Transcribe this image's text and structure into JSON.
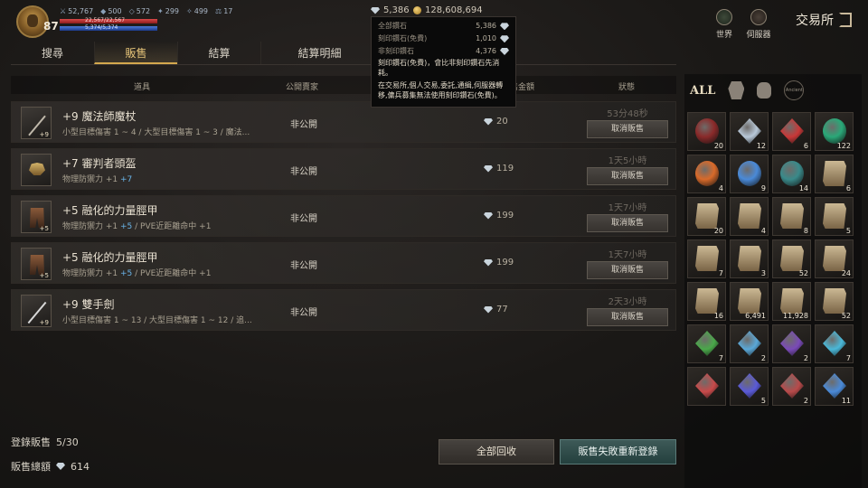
{
  "player": {
    "level": "87",
    "stats": [
      "52,767",
      "500",
      "572",
      "299",
      "499",
      "17"
    ],
    "hp_text": "22,567/22,567",
    "hp_fraction": 1.0,
    "mp_text": "5,374/5,374",
    "mp_fraction": 1.0
  },
  "currency": {
    "diamond": "5,386",
    "gold": "128,608,694"
  },
  "top_right": {
    "world_label": "世界",
    "server_label": "伺服器",
    "exchange_title": "交易所"
  },
  "tabs": [
    {
      "label": "搜尋",
      "active": false
    },
    {
      "label": "販售",
      "active": true
    },
    {
      "label": "結算",
      "active": false
    },
    {
      "label": "結算明細",
      "active": false
    }
  ],
  "columns": {
    "item": "道具",
    "public": "公開賣家",
    "amount": "售金額",
    "status": "狀態"
  },
  "tooltip": {
    "lines": [
      {
        "label": "全部鑽石",
        "value": "5,386"
      },
      {
        "label": "刻印鑽石(免費)",
        "value": "1,010"
      },
      {
        "label": "非刻印鑽石",
        "value": "4,376"
      }
    ],
    "note1": "刻印鑽石(免費)，會比非刻印鑽石先消耗。",
    "note2": "在交易所,個人交易,委託,通緝,伺服器轉移,傭兵募集無法使用刻印鑽石(免費)。"
  },
  "listings": [
    {
      "name": "+9 魔法師魔杖",
      "desc": "小型目標傷害 1 ~ 4 / 大型目標傷害 1 ~ 3 / 魔法...",
      "desc_blue": "",
      "desc_tail": "",
      "visibility": "非公開",
      "price": "20",
      "time": "53分48秒",
      "cancel": "取消販售",
      "plus": "+9",
      "icon": "staff"
    },
    {
      "name": "+7 審判者頭盔",
      "desc": "物理防禦力 +1 ",
      "desc_blue": "+7",
      "desc_tail": "",
      "visibility": "非公開",
      "price": "119",
      "time": "1天5小時",
      "cancel": "取消販售",
      "plus": "",
      "icon": "helm"
    },
    {
      "name": "+5 融化的力量脛甲",
      "desc": "物理防禦力 +1 ",
      "desc_blue": "+5",
      "desc_tail": " / PVE近距離命中 +1",
      "visibility": "非公開",
      "price": "199",
      "time": "1天7小時",
      "cancel": "取消販售",
      "plus": "+5",
      "icon": "legs"
    },
    {
      "name": "+5 融化的力量脛甲",
      "desc": "物理防禦力 +1 ",
      "desc_blue": "+5",
      "desc_tail": " / PVE近距離命中 +1",
      "visibility": "非公開",
      "price": "199",
      "time": "1天7小時",
      "cancel": "取消販售",
      "plus": "+5",
      "icon": "legs"
    },
    {
      "name": "+9 雙手劍",
      "desc": "小型目標傷害 1 ~ 13 / 大型目標傷害 1 ~ 12 / 追...",
      "desc_blue": "",
      "desc_tail": "",
      "visibility": "非公開",
      "price": "77",
      "time": "2天3小時",
      "cancel": "取消販售",
      "plus": "+9",
      "icon": "sword"
    }
  ],
  "summary": {
    "registered_label": "登錄販售",
    "registered_value": "5/30",
    "total_label": "販售總額",
    "total_value": "614"
  },
  "buttons": {
    "collect_all": "全部回收",
    "relist_failed": "販售失敗重新登錄"
  },
  "inventory": {
    "tabs": [
      "ALL",
      "helm",
      "bag",
      "Ancient"
    ],
    "items": [
      {
        "kind": "orb",
        "color": "#8a2a2a",
        "count": "20"
      },
      {
        "kind": "gem",
        "color": "#b8c8d8",
        "count": "12"
      },
      {
        "kind": "gem",
        "color": "#c83838",
        "count": "6"
      },
      {
        "kind": "orb",
        "color": "#2aa878",
        "count": "122"
      },
      {
        "kind": "orb",
        "color": "#d86a2a",
        "count": "4"
      },
      {
        "kind": "orb",
        "color": "#4a8ad8",
        "count": "9"
      },
      {
        "kind": "orb",
        "color": "#3a8a8a",
        "count": "14"
      },
      {
        "kind": "scroll",
        "color": "#cbb894",
        "count": "6"
      },
      {
        "kind": "scroll",
        "color": "#cbb894",
        "count": "20"
      },
      {
        "kind": "scroll",
        "color": "#cbb894",
        "count": "4"
      },
      {
        "kind": "scroll",
        "color": "#cbb894",
        "count": "8"
      },
      {
        "kind": "scroll",
        "color": "#cbb894",
        "count": "5"
      },
      {
        "kind": "scroll",
        "color": "#cbb894",
        "count": "7"
      },
      {
        "kind": "scroll",
        "color": "#cbb894",
        "count": "3"
      },
      {
        "kind": "scroll",
        "color": "#cbb894",
        "count": "52"
      },
      {
        "kind": "scroll",
        "color": "#cbb894",
        "count": "24"
      },
      {
        "kind": "scroll",
        "color": "#cbb894",
        "count": "16"
      },
      {
        "kind": "scroll",
        "color": "#cbb894",
        "count": "6,491"
      },
      {
        "kind": "scroll",
        "color": "#cbb894",
        "count": "11,928"
      },
      {
        "kind": "scroll",
        "color": "#cbb894",
        "count": "52"
      },
      {
        "kind": "gem",
        "color": "#4aa84a",
        "count": "7"
      },
      {
        "kind": "gem",
        "color": "#5aa8d8",
        "count": "2"
      },
      {
        "kind": "gem",
        "color": "#7a4ab8",
        "count": "2"
      },
      {
        "kind": "gem",
        "color": "#4ab8d8",
        "count": "7"
      },
      {
        "kind": "gem",
        "color": "#c84a4a",
        "count": ""
      },
      {
        "kind": "gem",
        "color": "#5a5ad8",
        "count": "5"
      },
      {
        "kind": "gem",
        "color": "#b84a4a",
        "count": "2"
      },
      {
        "kind": "gem",
        "color": "#4a8ad8",
        "count": "11"
      }
    ]
  }
}
